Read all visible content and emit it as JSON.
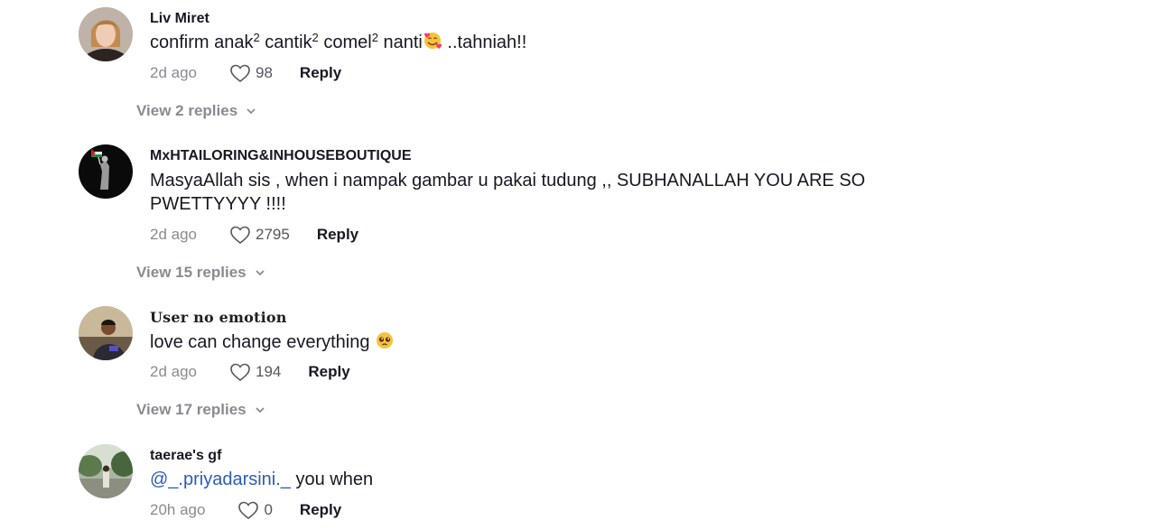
{
  "comments": [
    {
      "username": "Liv Miret",
      "text_parts": [
        "confirm anak",
        "2",
        " cantik",
        "2",
        " comel",
        "2",
        " nanti",
        " ..tahniah!!"
      ],
      "time": "2d ago",
      "likes": "98",
      "reply_label": "Reply",
      "view_replies": "View 2 replies",
      "emoji": "smiling-face-with-hearts-icon"
    },
    {
      "username": "MxHTAILORING&INHOUSEBOUTIQUE",
      "text": "MasyaAllah sis , when i nampak gambar u pakai tudung ,, SUBHANALLAH YOU ARE SO PWETTYYYY !!!!",
      "time": "2d ago",
      "likes": "2795",
      "reply_label": "Reply",
      "view_replies": "View 15 replies"
    },
    {
      "username": "User no emotion",
      "text": "love can change everything",
      "time": "2d ago",
      "likes": "194",
      "reply_label": "Reply",
      "view_replies": "View 17 replies",
      "emoji": "pleading-face-icon"
    },
    {
      "username": "taerae's gf",
      "mention": "@_.priyadarsini._",
      "text": " you when",
      "time": "20h ago",
      "likes": "0",
      "reply_label": "Reply"
    }
  ],
  "colors": {
    "text": "#161823",
    "muted": "#8a8b91",
    "mention": "#2b5db9"
  }
}
